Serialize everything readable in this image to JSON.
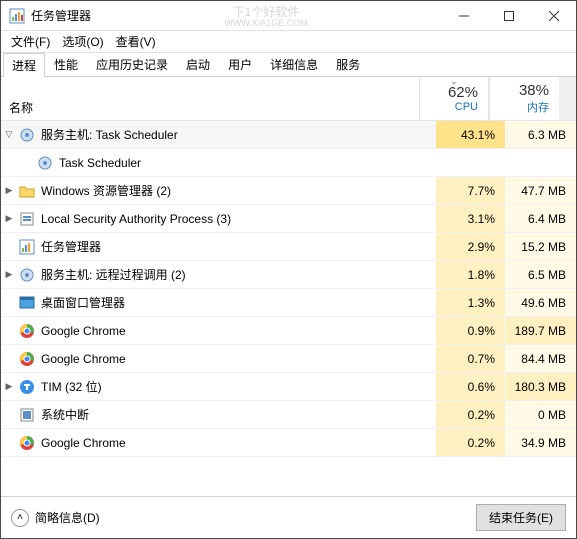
{
  "titlebar": {
    "title": "任务管理器",
    "watermark_main": "下1个好软件",
    "watermark_sub": "WWW.XIA1GE.COM"
  },
  "menu": {
    "file": "文件(F)",
    "options": "选项(O)",
    "view": "查看(V)"
  },
  "tabs": {
    "processes": "进程",
    "performance": "性能",
    "history": "应用历史记录",
    "startup": "启动",
    "users": "用户",
    "details": "详细信息",
    "services": "服务"
  },
  "header": {
    "name": "名称",
    "cpu_pct": "62%",
    "cpu_lbl": "CPU",
    "mem_pct": "38%",
    "mem_lbl": "内存"
  },
  "processes": [
    {
      "icon": "gear",
      "name": "服务主机: Task Scheduler",
      "cpu": "43.1%",
      "mem": "6.3 MB",
      "expanded": true,
      "chevron": "down",
      "cpuHigh": true
    },
    {
      "icon": "gear",
      "name": "Task Scheduler",
      "cpu": "",
      "mem": "",
      "child": true
    },
    {
      "icon": "folder",
      "name": "Windows 资源管理器 (2)",
      "cpu": "7.7%",
      "mem": "47.7 MB",
      "chevron": "right"
    },
    {
      "icon": "shield",
      "name": "Local Security Authority Process (3)",
      "cpu": "3.1%",
      "mem": "6.4 MB",
      "chevron": "right"
    },
    {
      "icon": "taskmgr",
      "name": "任务管理器",
      "cpu": "2.9%",
      "mem": "15.2 MB"
    },
    {
      "icon": "gear",
      "name": "服务主机: 远程过程调用 (2)",
      "cpu": "1.8%",
      "mem": "6.5 MB",
      "chevron": "right"
    },
    {
      "icon": "dwm",
      "name": "桌面窗口管理器",
      "cpu": "1.3%",
      "mem": "49.6 MB"
    },
    {
      "icon": "chrome",
      "name": "Google Chrome",
      "cpu": "0.9%",
      "mem": "189.7 MB",
      "memHigh": true
    },
    {
      "icon": "chrome",
      "name": "Google Chrome",
      "cpu": "0.7%",
      "mem": "84.4 MB"
    },
    {
      "icon": "tim",
      "name": "TIM (32 位)",
      "cpu": "0.6%",
      "mem": "180.3 MB",
      "chevron": "right",
      "memHigh": true
    },
    {
      "icon": "system",
      "name": "系统中断",
      "cpu": "0.2%",
      "mem": "0 MB"
    },
    {
      "icon": "chrome",
      "name": "Google Chrome",
      "cpu": "0.2%",
      "mem": "34.9 MB"
    }
  ],
  "footer": {
    "fewer": "简略信息(D)",
    "end_task": "结束任务(E)"
  },
  "colors": {
    "accent": "#1a6fb8",
    "cpu_col": "#fff0c2",
    "mem_col": "#fff9e6"
  }
}
